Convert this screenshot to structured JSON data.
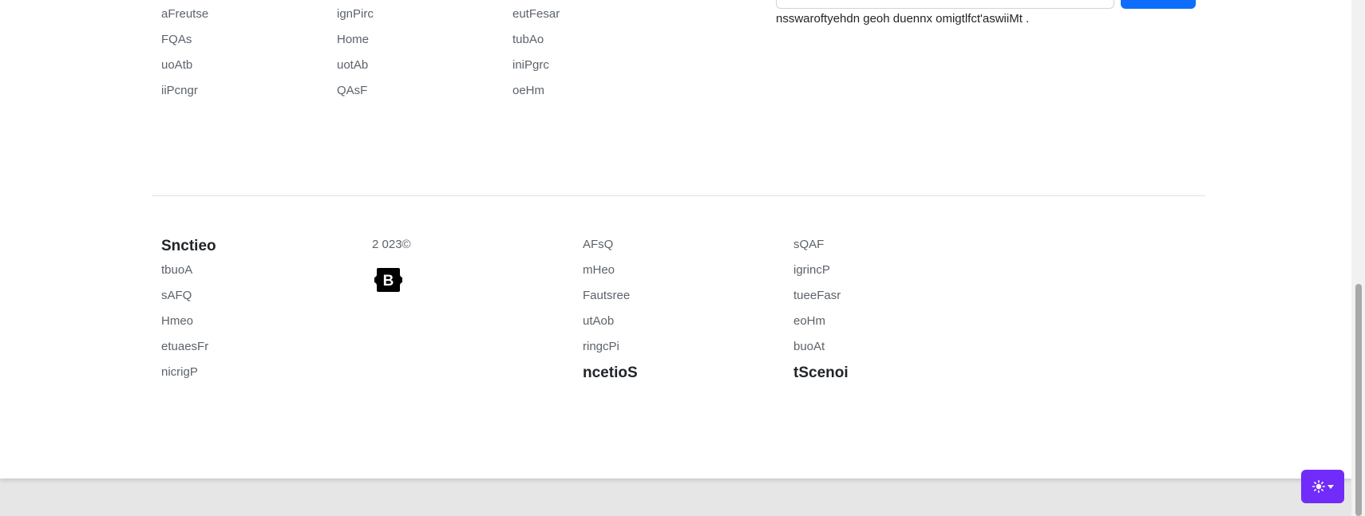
{
  "top_links": {
    "col1": [
      "aFreutse",
      "FQAs",
      "uoAtb",
      "iiPcngr"
    ],
    "col2": [
      "ignPirc",
      "Home",
      "uotAb",
      "QAsF"
    ],
    "col3": [
      "eutFesar",
      "tubAo",
      "iniPgrc",
      "oeHm"
    ]
  },
  "newsletter": {
    "note": "nsswaroftyehdn geoh duennx omigtlfct'aswiiMt ."
  },
  "footer": {
    "col1": {
      "heading": "Snctieo",
      "links": [
        "tbuoA",
        "sAFQ",
        "Hmeo",
        "etuaesFr",
        "nicrigP"
      ]
    },
    "copyright": "2 023©",
    "logo_letter": "B",
    "col3": {
      "links": [
        "AFsQ",
        "mHeo",
        "Fautsree",
        "utAob",
        "ringcPi"
      ],
      "heading": "ncetioS"
    },
    "col4": {
      "links": [
        "sQAF",
        "igrincP",
        "tueeFasr",
        "eoHm",
        "buoAt"
      ],
      "heading": "tScenoi"
    }
  },
  "theme_toggle": {
    "icon": "sun-icon",
    "accent": "#712cf9"
  },
  "colors": {
    "link": "#5c636a",
    "heading": "#212529",
    "primary": "#0d6efd"
  }
}
